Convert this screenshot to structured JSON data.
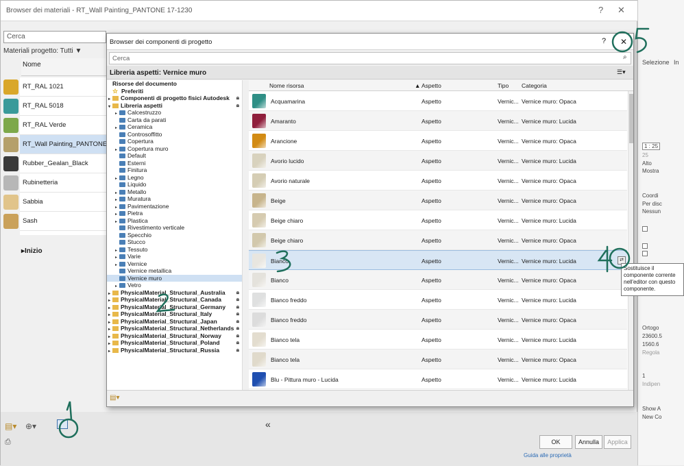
{
  "material_browser": {
    "title": "Browser dei materiali - RT_Wall Painting_PANTONE 17-1230",
    "help": "?",
    "close": "✕",
    "search_placeholder": "Cerca",
    "filter_label": "Materiali progetto: Tutti",
    "column_name": "Nome",
    "materials": [
      {
        "label": "RT_RAL 1021",
        "color": "#d9a72a"
      },
      {
        "label": "RT_RAL 5018",
        "color": "#3a9a9a"
      },
      {
        "label": "RT_RAL Verde",
        "color": "#7da84a"
      },
      {
        "label": "RT_Wall Painting_PANTONE",
        "color": "#b5a06a"
      },
      {
        "label": "Rubber_Gealan_Black",
        "color": "#3a3a3a"
      },
      {
        "label": "Rubinetteria",
        "color": "#b7b7b7"
      },
      {
        "label": "Sabbia",
        "color": "#e1c48a"
      },
      {
        "label": "Sash",
        "color": "#caa15a"
      }
    ],
    "inizio_label": "Inizio",
    "collapse_label": "«",
    "ok_label": "OK",
    "cancel_label": "Annulla",
    "apply_label": "Applica"
  },
  "right_panel": {
    "selezione": "Selezione",
    "in": "In",
    "scale": "1 : 25",
    "scale_val": "25",
    "alto": "Alto",
    "mostra": "Mostra",
    "coord": "Coordi",
    "per_disc": "Per disc",
    "nessun": "Nessun",
    "ortogo": "Ortogo",
    "val1": "23600.5",
    "val2": "1560.6",
    "regola": "Regola",
    "one": "1",
    "indip": "Indipen",
    "show": "Show A",
    "newc": "New Co",
    "guide": "Guida alle proprietà"
  },
  "dialog": {
    "title": "Browser dei componenti di progetto",
    "help": "?",
    "close": "✕",
    "search_placeholder": "Cerca",
    "library_header": "Libreria aspetti: Vernice muro",
    "tree": [
      {
        "label": "Risorse del documento",
        "indent": 0,
        "icon": "none",
        "arrow": "",
        "bold": true
      },
      {
        "label": "Preferiti",
        "indent": 0,
        "icon": "star",
        "arrow": "",
        "bold": true
      },
      {
        "label": "Componenti di progetto fisici Autodesk",
        "indent": 0,
        "icon": "yel",
        "arrow": "▸",
        "bold": true,
        "lock": true
      },
      {
        "label": "Libreria aspetti",
        "indent": 0,
        "icon": "yel",
        "arrow": "▾",
        "bold": true,
        "lock": true
      },
      {
        "label": "Calcestruzzo",
        "indent": 1,
        "icon": "blue",
        "arrow": "▸"
      },
      {
        "label": "Carta da parati",
        "indent": 1,
        "icon": "blue",
        "arrow": ""
      },
      {
        "label": "Ceramica",
        "indent": 1,
        "icon": "blue",
        "arrow": "▸"
      },
      {
        "label": "Controsoffitto",
        "indent": 1,
        "icon": "blue",
        "arrow": ""
      },
      {
        "label": "Copertura",
        "indent": 1,
        "icon": "blue",
        "arrow": ""
      },
      {
        "label": "Copertura muro",
        "indent": 1,
        "icon": "blue",
        "arrow": "▸"
      },
      {
        "label": "Default",
        "indent": 1,
        "icon": "blue",
        "arrow": ""
      },
      {
        "label": "Esterni",
        "indent": 1,
        "icon": "blue",
        "arrow": ""
      },
      {
        "label": "Finitura",
        "indent": 1,
        "icon": "blue",
        "arrow": ""
      },
      {
        "label": "Legno",
        "indent": 1,
        "icon": "blue",
        "arrow": "▸"
      },
      {
        "label": "Liquido",
        "indent": 1,
        "icon": "blue",
        "arrow": ""
      },
      {
        "label": "Metallo",
        "indent": 1,
        "icon": "blue",
        "arrow": "▸"
      },
      {
        "label": "Muratura",
        "indent": 1,
        "icon": "blue",
        "arrow": "▸"
      },
      {
        "label": "Pavimentazione",
        "indent": 1,
        "icon": "blue",
        "arrow": "▸"
      },
      {
        "label": "Pietra",
        "indent": 1,
        "icon": "blue",
        "arrow": "▸"
      },
      {
        "label": "Plastica",
        "indent": 1,
        "icon": "blue",
        "arrow": "▸"
      },
      {
        "label": "Rivestimento verticale",
        "indent": 1,
        "icon": "blue",
        "arrow": ""
      },
      {
        "label": "Specchio",
        "indent": 1,
        "icon": "blue",
        "arrow": ""
      },
      {
        "label": "Stucco",
        "indent": 1,
        "icon": "blue",
        "arrow": ""
      },
      {
        "label": "Tessuto",
        "indent": 1,
        "icon": "blue",
        "arrow": "▸"
      },
      {
        "label": "Varie",
        "indent": 1,
        "icon": "blue",
        "arrow": "▸"
      },
      {
        "label": "Vernice",
        "indent": 1,
        "icon": "blue",
        "arrow": "▸"
      },
      {
        "label": "Vernice metallica",
        "indent": 1,
        "icon": "blue",
        "arrow": ""
      },
      {
        "label": "Vernice muro",
        "indent": 1,
        "icon": "blue",
        "arrow": "",
        "selected": true
      },
      {
        "label": "Vetro",
        "indent": 1,
        "icon": "blue",
        "arrow": "▸"
      },
      {
        "label": "PhysicalMaterial_Structural_Australia",
        "indent": 0,
        "icon": "yel",
        "arrow": "▸",
        "bold": true,
        "lock": true
      },
      {
        "label": "PhysicalMaterial_Structural_Canada",
        "indent": 0,
        "icon": "yel",
        "arrow": "▸",
        "bold": true,
        "lock": true
      },
      {
        "label": "PhysicalMaterial_Structural_Germany",
        "indent": 0,
        "icon": "yel",
        "arrow": "▸",
        "bold": true,
        "lock": true
      },
      {
        "label": "PhysicalMaterial_Structural_Italy",
        "indent": 0,
        "icon": "yel",
        "arrow": "▸",
        "bold": true,
        "lock": true
      },
      {
        "label": "PhysicalMaterial_Structural_Japan",
        "indent": 0,
        "icon": "yel",
        "arrow": "▸",
        "bold": true,
        "lock": true
      },
      {
        "label": "PhysicalMaterial_Structural_Netherlands",
        "indent": 0,
        "icon": "yel",
        "arrow": "▸",
        "bold": true,
        "lock": true
      },
      {
        "label": "PhysicalMaterial_Structural_Norway",
        "indent": 0,
        "icon": "yel",
        "arrow": "▸",
        "bold": true,
        "lock": true
      },
      {
        "label": "PhysicalMaterial_Structural_Poland",
        "indent": 0,
        "icon": "yel",
        "arrow": "▸",
        "bold": true,
        "lock": true
      },
      {
        "label": "PhysicalMaterial_Structural_Russia",
        "indent": 0,
        "icon": "yel",
        "arrow": "▸",
        "bold": true,
        "lock": true
      }
    ],
    "columns": {
      "name": "Nome risorsa",
      "aspect": "Aspetto",
      "type": "Tipo",
      "category": "Categoria"
    },
    "rows": [
      {
        "name": "Acquamarina",
        "aspect": "Aspetto",
        "type": "Vernic...",
        "category": "Vernice muro: Opaca",
        "color": "#2f8f86"
      },
      {
        "name": "Amaranto",
        "aspect": "Aspetto",
        "type": "Vernic...",
        "category": "Vernice muro: Lucida",
        "color": "#8f1f3c"
      },
      {
        "name": "Arancione",
        "aspect": "Aspetto",
        "type": "Vernic...",
        "category": "Vernice muro: Opaca",
        "color": "#d28b14"
      },
      {
        "name": "Avorio lucido",
        "aspect": "Aspetto",
        "type": "Vernic...",
        "category": "Vernice muro: Lucida",
        "color": "#d8d2be"
      },
      {
        "name": "Avorio naturale",
        "aspect": "Aspetto",
        "type": "Vernic...",
        "category": "Vernice muro: Opaca",
        "color": "#d5cdb4"
      },
      {
        "name": "Beige",
        "aspect": "Aspetto",
        "type": "Vernic...",
        "category": "Vernice muro: Opaca",
        "color": "#c7b48c"
      },
      {
        "name": "Beige chiaro",
        "aspect": "Aspetto",
        "type": "Vernic...",
        "category": "Vernice muro: Lucida",
        "color": "#d6cbb0"
      },
      {
        "name": "Beige chiaro",
        "aspect": "Aspetto",
        "type": "Vernic...",
        "category": "Vernice muro: Opaca",
        "color": "#d2c8ac"
      },
      {
        "name": "Bianco",
        "aspect": "Aspetto",
        "type": "Vernic...",
        "category": "Vernice muro: Lucida",
        "color": "#e8e6e0",
        "selected": true
      },
      {
        "name": "Bianco",
        "aspect": "Aspetto",
        "type": "Vernic...",
        "category": "Vernice muro: Opaca",
        "color": "#e4e2dc"
      },
      {
        "name": "Bianco freddo",
        "aspect": "Aspetto",
        "type": "Vernic...",
        "category": "Vernice muro: Lucida",
        "color": "#dfe0e0"
      },
      {
        "name": "Bianco freddo",
        "aspect": "Aspetto",
        "type": "Vernic...",
        "category": "Vernice muro: Opaca",
        "color": "#dcdcdc"
      },
      {
        "name": "Bianco tela",
        "aspect": "Aspetto",
        "type": "Vernic...",
        "category": "Vernice muro: Lucida",
        "color": "#e3ddcf"
      },
      {
        "name": "Bianco tela",
        "aspect": "Aspetto",
        "type": "Vernic...",
        "category": "Vernice muro: Opaca",
        "color": "#e0dacb"
      },
      {
        "name": "Blu - Pittura muro - Lucida",
        "aspect": "Aspetto",
        "type": "Vernic...",
        "category": "Vernice muro: Lucida",
        "color": "#1f4fb0"
      }
    ],
    "tooltip": "Sostituisce il componente corrente nell'editor con questo componente."
  },
  "annotations": [
    "1",
    "2",
    "3",
    "4",
    "5"
  ],
  "colors": {
    "accent": "#1f6f5c",
    "selection": "#cfe0f3"
  }
}
